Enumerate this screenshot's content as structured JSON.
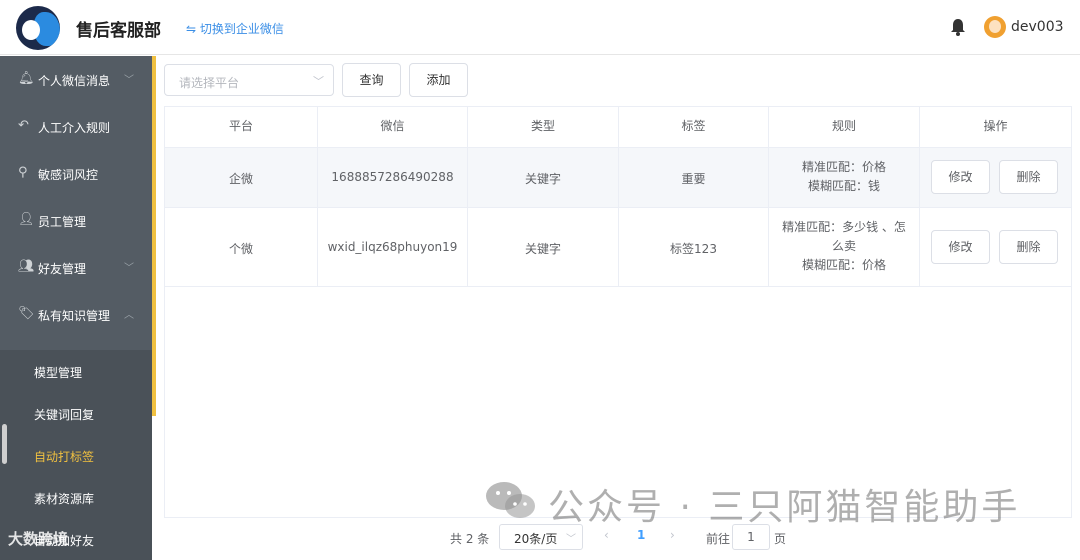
{
  "header": {
    "brand": "售后客服部",
    "switch_label": "⇋ 切换到企业微信",
    "username": "dev003"
  },
  "sidebar": {
    "items": [
      {
        "label": "个人微信消息",
        "icon": "bell-icon"
      },
      {
        "label": "人工介入规则",
        "icon": "reply-icon"
      },
      {
        "label": "敏感词风控",
        "icon": "search-icon"
      },
      {
        "label": "员工管理",
        "icon": "user-add-icon"
      },
      {
        "label": "好友管理",
        "icon": "users-icon"
      },
      {
        "label": "私有知识管理",
        "icon": "tags-icon"
      }
    ],
    "sub_items": [
      {
        "label": "模型管理"
      },
      {
        "label": "关键词回复"
      },
      {
        "label": "自动打标签"
      },
      {
        "label": "素材资源库"
      },
      {
        "label": "自动加好友"
      }
    ],
    "watermark": "大数跨境"
  },
  "toolbar": {
    "platform_placeholder": "请选择平台",
    "query_label": "查询",
    "add_label": "添加"
  },
  "table": {
    "headers": [
      "平台",
      "微信",
      "类型",
      "标签",
      "规则",
      "操作"
    ],
    "rows": [
      {
        "platform": "企微",
        "wechat": "1688857286490288",
        "type": "关键字",
        "tag": "重要",
        "rule_lines": [
          "精准匹配：价格",
          "模糊匹配：钱"
        ],
        "edit_label": "修改",
        "delete_label": "删除"
      },
      {
        "platform": "个微",
        "wechat": "wxid_ilqz68phuyon19",
        "type": "关键字",
        "tag": "标签123",
        "rule_lines": [
          "精准匹配：多少钱 、怎",
          "么卖",
          "模糊匹配：价格"
        ],
        "edit_label": "修改",
        "delete_label": "删除"
      }
    ]
  },
  "pagination": {
    "total": "共 2 条",
    "page_size": "20条/页",
    "current_page": "1",
    "goto_label": "前往",
    "goto_value": "1",
    "page_suffix": "页"
  },
  "watermark": {
    "text": "公众号 · 三只阿猫智能助手"
  }
}
